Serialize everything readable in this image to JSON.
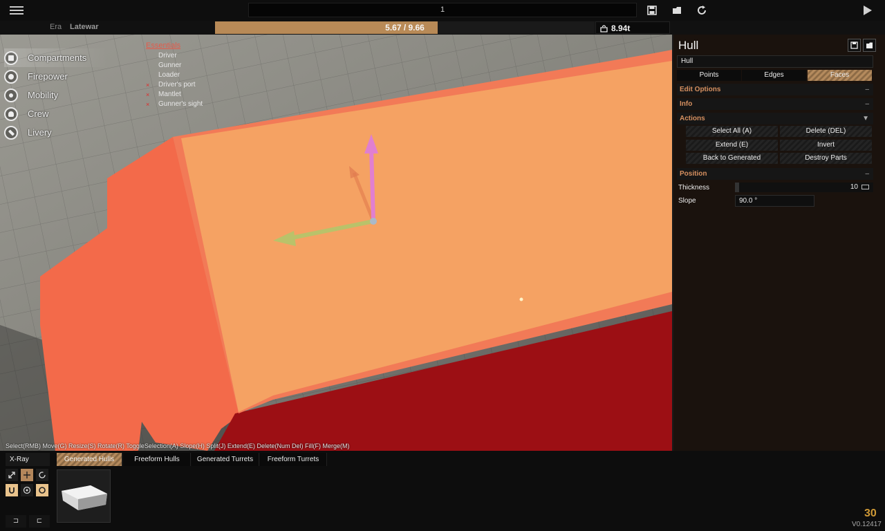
{
  "topbar": {
    "session_value": "1",
    "icons": [
      "menu-icon",
      "save-icon",
      "load-icon",
      "reset-icon",
      "play-icon"
    ]
  },
  "infobar": {
    "era_label": "Era",
    "era_value": "Latewar",
    "battle_rating_text": "5.67 / 9.66",
    "battle_rating_fraction": 0.5873,
    "weight_text": "8.94t"
  },
  "leftnav": {
    "items": [
      {
        "label": "Compartments",
        "icon": "compartments-icon"
      },
      {
        "label": "Firepower",
        "icon": "firepower-icon"
      },
      {
        "label": "Mobility",
        "icon": "mobility-icon"
      },
      {
        "label": "Crew",
        "icon": "crew-icon"
      },
      {
        "label": "Livery",
        "icon": "livery-icon"
      }
    ]
  },
  "essentials": {
    "title": "Essentials",
    "items": [
      {
        "label": "Driver",
        "mark": ""
      },
      {
        "label": "Gunner",
        "mark": ""
      },
      {
        "label": "Loader",
        "mark": ""
      },
      {
        "label": "Driver's port",
        "mark": "×"
      },
      {
        "label": "Mantlet",
        "mark": "×"
      },
      {
        "label": "Gunner's sight",
        "mark": "×"
      }
    ]
  },
  "hotkeys": "Select(RMB) Move(G) Resize(S) Rotate(R) ToggleSelection(A) Slope(H) Split(J) Extend(E) Delete(Num Del) Fill(F) Merge(M)",
  "panel": {
    "title": "Hull",
    "name_value": "Hull",
    "mode_tabs": [
      "Points",
      "Edges",
      "Faces"
    ],
    "active_mode": "Faces",
    "sections": {
      "edit_options": "Edit Options",
      "info": "Info",
      "actions": "Actions",
      "position": "Position"
    },
    "toggles": {
      "collapsed": "–",
      "expanded": "▼"
    },
    "actions": [
      "Select All (A)",
      "Delete (DEL)",
      "Extend (E)",
      "Invert",
      "Back to Generated",
      "Destroy Parts"
    ],
    "thickness_label": "Thickness",
    "thickness_value": "10",
    "thickness_fraction": 0.03,
    "slope_label": "Slope",
    "slope_value": "90.0 °"
  },
  "bottom": {
    "xray_label": "X-Ray",
    "tabs": [
      "Generated Hulls",
      "Freeform Hulls",
      "Generated Turrets",
      "Freeform Turrets"
    ],
    "active_tab": "Generated Hulls",
    "small_buttons": [
      "⊐",
      "⊏"
    ],
    "fps": "30",
    "version": "V0.12417"
  },
  "colors": {
    "accent": "#b88a57",
    "hull_top": "#f5a263",
    "hull_side": "#f36a4a",
    "hull_dark": "#9a0c0c",
    "section_text": "#d69060"
  }
}
